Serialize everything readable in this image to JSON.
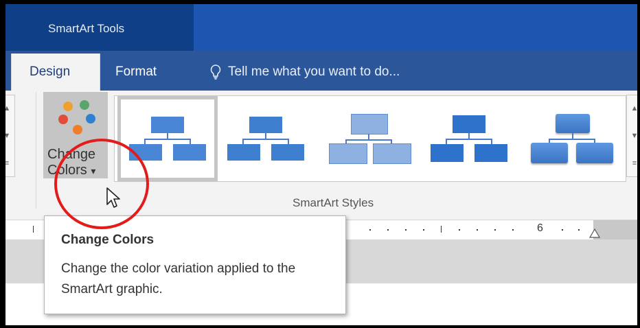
{
  "contextual_tab_group": {
    "label": "SmartArt Tools"
  },
  "tabs": [
    {
      "label": "Design",
      "active": true
    },
    {
      "label": "Format",
      "active": false
    }
  ],
  "tell_me": {
    "placeholder": "Tell me what you want to do...",
    "icon": "lightbulb-icon"
  },
  "change_colors": {
    "line1": "Change",
    "line2": "Colors",
    "dropdown_arrow": "▾",
    "icon": "color-dots-icon"
  },
  "gallery": {
    "group_label": "SmartArt Styles",
    "selected_index": 0,
    "item_count": 5
  },
  "ruler": {
    "marker_label": "6"
  },
  "tooltip": {
    "title": "Change Colors",
    "body": "Change the color variation applied to the SmartArt graphic."
  },
  "colors": {
    "title_dark": "#0f3f87",
    "title_band": "#1d55b1",
    "tab_row": "#2b579a",
    "accent_blue": "#4a7bc8",
    "highlight_red": "#e31b1b"
  }
}
